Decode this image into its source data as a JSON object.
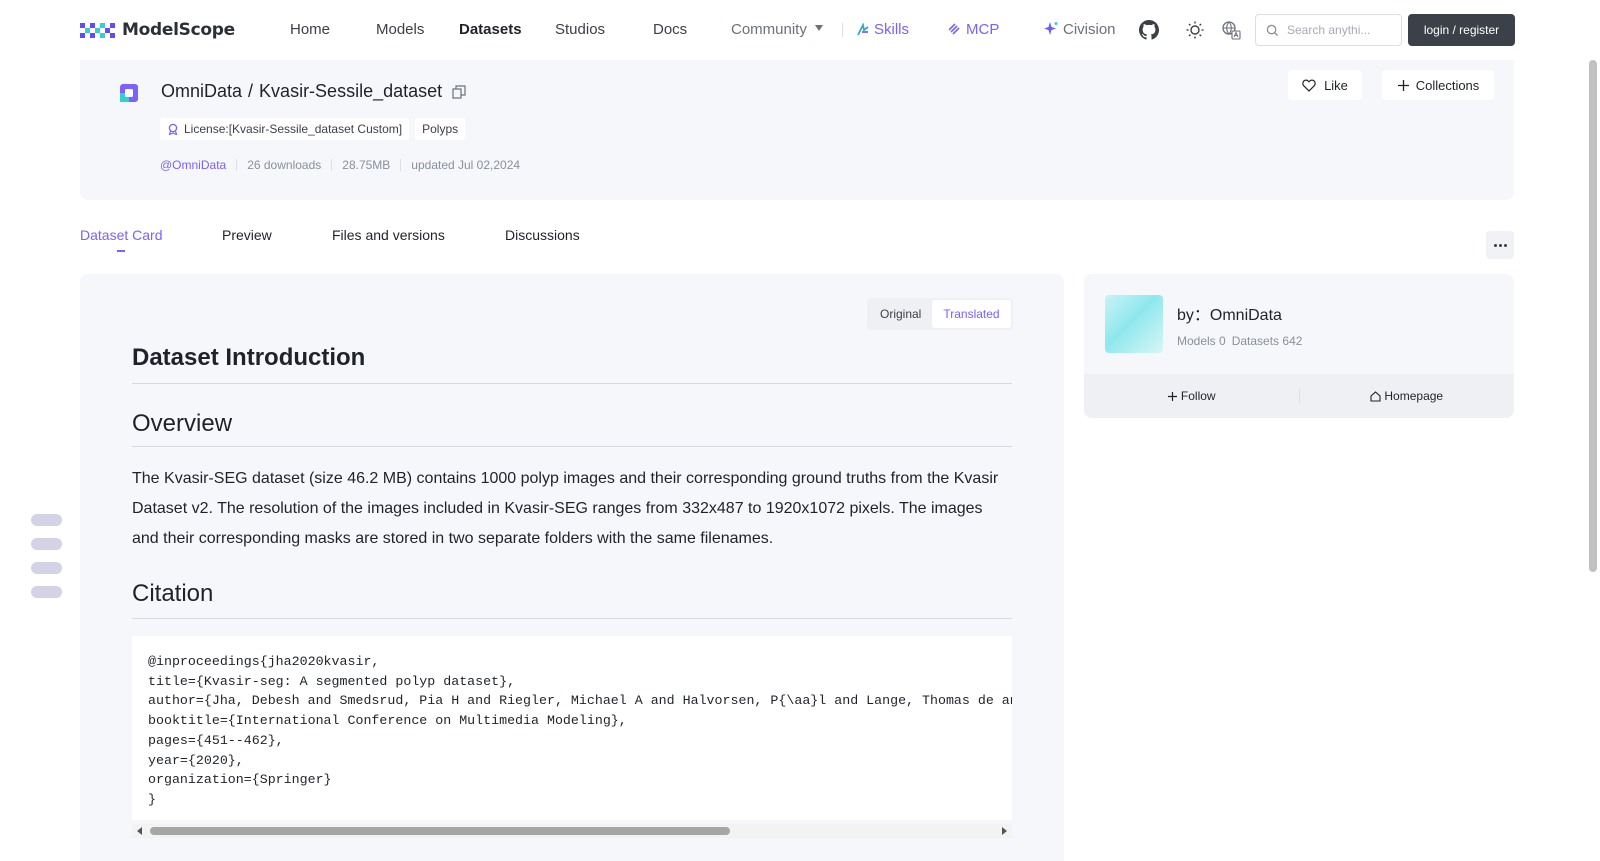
{
  "brand": {
    "name": "ModelScope"
  },
  "nav": {
    "home": "Home",
    "models": "Models",
    "datasets": "Datasets",
    "studios": "Studios",
    "docs": "Docs",
    "community": "Community",
    "skills": "Skills",
    "mcp": "MCP",
    "civision": "Civision",
    "search_placeholder": "Search anythi...",
    "login": "login / register"
  },
  "dataset": {
    "owner": "OmniData",
    "separator": "/",
    "name": "Kvasir-Sessile_dataset",
    "license": "License:[Kvasir-Sessile_dataset Custom]",
    "tag": "Polyps",
    "owner_handle": "@OmniData",
    "downloads": "26 downloads",
    "size": "28.75MB",
    "updated": "updated Jul 02,2024",
    "like": "Like",
    "collections": "Collections"
  },
  "tabs": {
    "card": "Dataset Card",
    "preview": "Preview",
    "files": "Files and versions",
    "discussions": "Discussions"
  },
  "toggle": {
    "original": "Original",
    "translated": "Translated",
    "selected": "Translated"
  },
  "content": {
    "title": "Dataset Introduction",
    "overview_heading": "Overview",
    "overview_text": "The Kvasir-SEG dataset (size 46.2 MB) contains 1000 polyp images and their corresponding ground truths from the Kvasir Dataset v2. The resolution of the images included in Kvasir-SEG ranges from 332x487 to 1920x1072 pixels. The images and their corresponding masks are stored in two separate folders with the same filenames.",
    "citation_heading": "Citation",
    "citation_code": "@inproceedings{jha2020kvasir,\ntitle={Kvasir-seg: A segmented polyp dataset},\nauthor={Jha, Debesh and Smedsrud, Pia H and Riegler, Michael A and Halvorsen, P{\\aa}l and Lange, Thomas de and Johansen, Dag and Johansen, H{\\aa}vard D},\nbooktitle={International Conference on Multimedia Modeling},\npages={451--462},\nyear={2020},\norganization={Springer}\n}"
  },
  "author": {
    "by_label": "by：OmniData",
    "models": "Models 0",
    "datasets": "Datasets 642",
    "follow": "Follow",
    "homepage": "Homepage"
  },
  "colors": {
    "accent": "#7b61ff",
    "panel": "#f6f7fb",
    "login_bg": "#3c4048"
  }
}
